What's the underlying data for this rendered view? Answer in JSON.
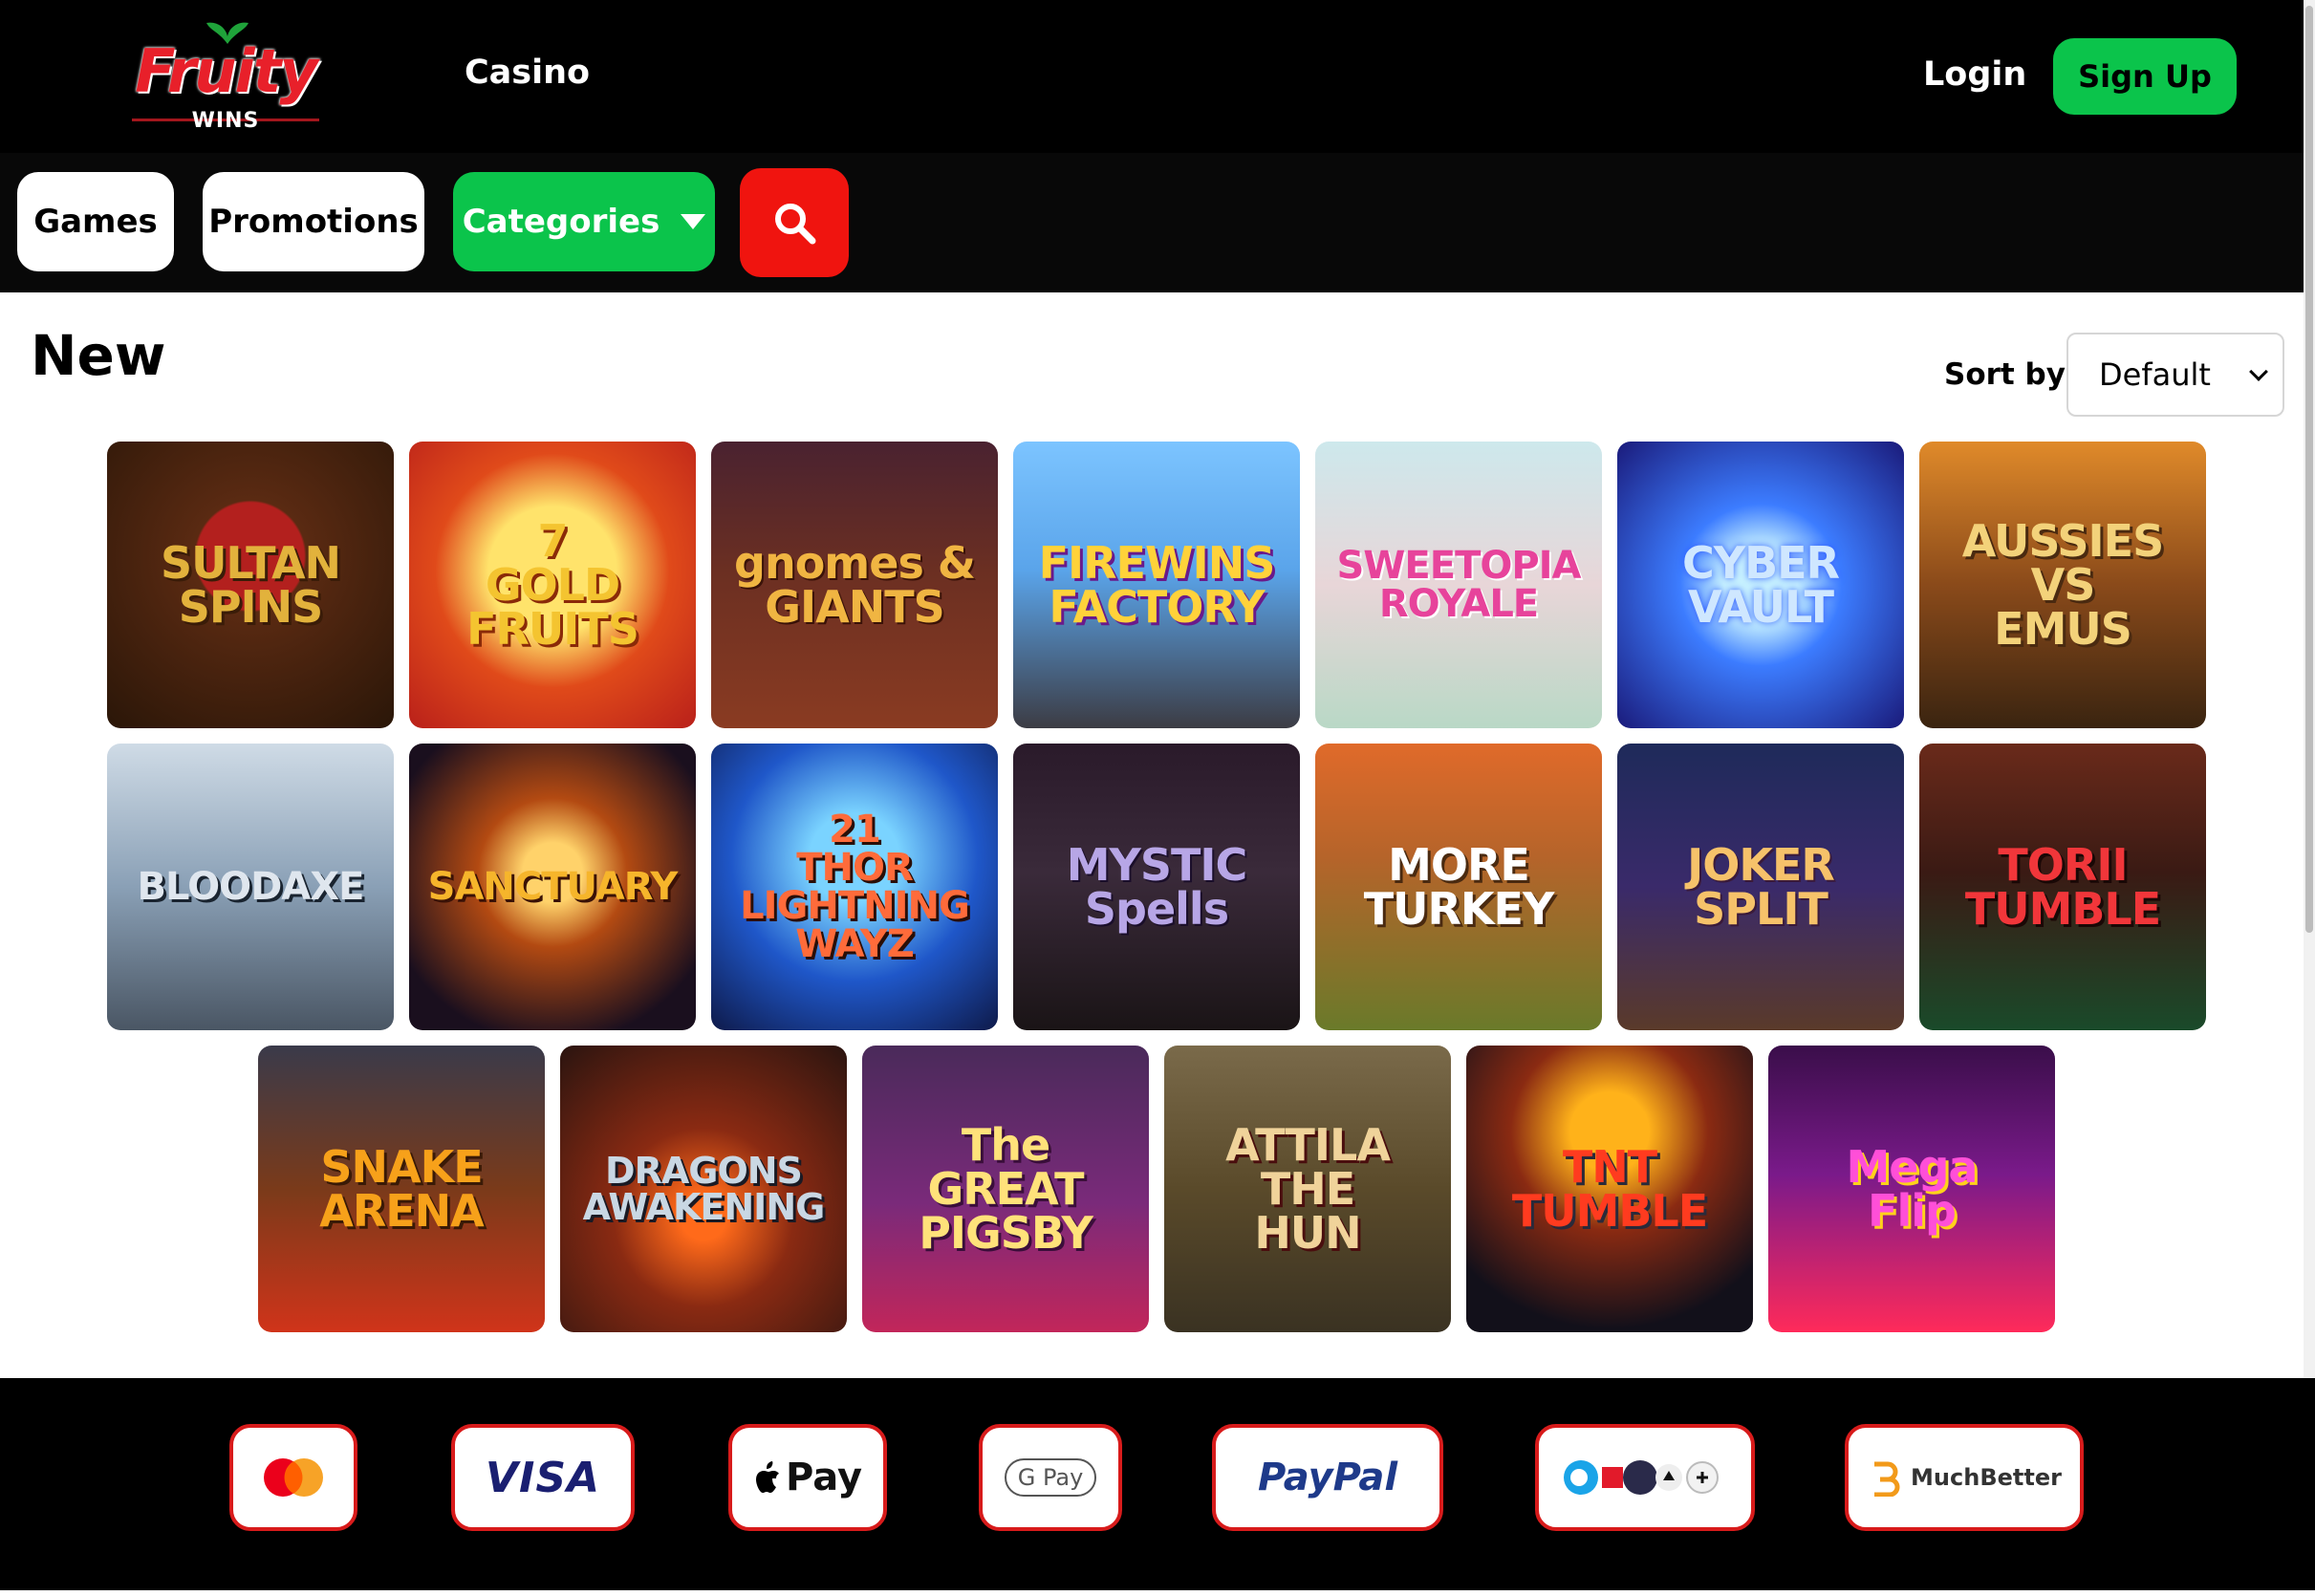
{
  "header": {
    "logo_text": "Fruity",
    "logo_sub": "WINS",
    "nav_casino": "Casino",
    "login_label": "Login",
    "signup_label": "Sign Up"
  },
  "subnav": {
    "games_label": "Games",
    "promotions_label": "Promotions",
    "categories_label": "Categories"
  },
  "main": {
    "title": "New",
    "sort_label": "Sort by:",
    "sort_value": "Default"
  },
  "games": [
    {
      "title": "SULTAN\nSPINS",
      "color": "#e2b23c"
    },
    {
      "title": "7\nGOLD\nFRUITS",
      "color": "#f4c430"
    },
    {
      "title": "gnomes &\nGIANTS",
      "color": "#f0b542"
    },
    {
      "title": "FIREWINS\nFACTORY",
      "color": "#ffd23a"
    },
    {
      "title": "SWEETOPIA\nROYALE",
      "color": "#e7439b"
    },
    {
      "title": "CYBER\nVAULT",
      "color": "#cfe7ff"
    },
    {
      "title": "AUSSIES\nVS\nEMUS",
      "color": "#f3d27a"
    },
    {
      "title": "BLOODAXE",
      "color": "#dfe6ee"
    },
    {
      "title": "SANCTUARY",
      "color": "#f6b52b"
    },
    {
      "title": "21\nTHOR\nLIGHTNING WAYZ",
      "color": "#ff6b3a"
    },
    {
      "title": "MYSTIC\nSpells",
      "color": "#b7a6e6"
    },
    {
      "title": "MORE\nTURKEY",
      "color": "#ffffff"
    },
    {
      "title": "JOKER\nSPLIT",
      "color": "#f6c26a"
    },
    {
      "title": "TORII\nTUMBLE",
      "color": "#f1363a"
    },
    {
      "title": "SNAKE\nARENA",
      "color": "#f7a11a"
    },
    {
      "title": "DRAGONS\nAWAKENING",
      "color": "#c9d7e3"
    },
    {
      "title": "The\nGREAT\nPIGSBY",
      "color": "#ffe27a"
    },
    {
      "title": "ATTILA\nTHE\nHUN",
      "color": "#f0d39a"
    },
    {
      "title": "TNT\nTUMBLE",
      "color": "#ff3b1f"
    },
    {
      "title": "Mega\nFlip",
      "color": "#ff4fd8"
    }
  ],
  "payments": {
    "visa": "VISA",
    "applepay": "Pay",
    "gpay": "G Pay",
    "paypal": "PayPal",
    "muchbetter": "MuchBetter"
  },
  "colors": {
    "accent_green": "#0bc44b",
    "accent_red": "#f0140f",
    "payment_border": "#d81b1b"
  }
}
